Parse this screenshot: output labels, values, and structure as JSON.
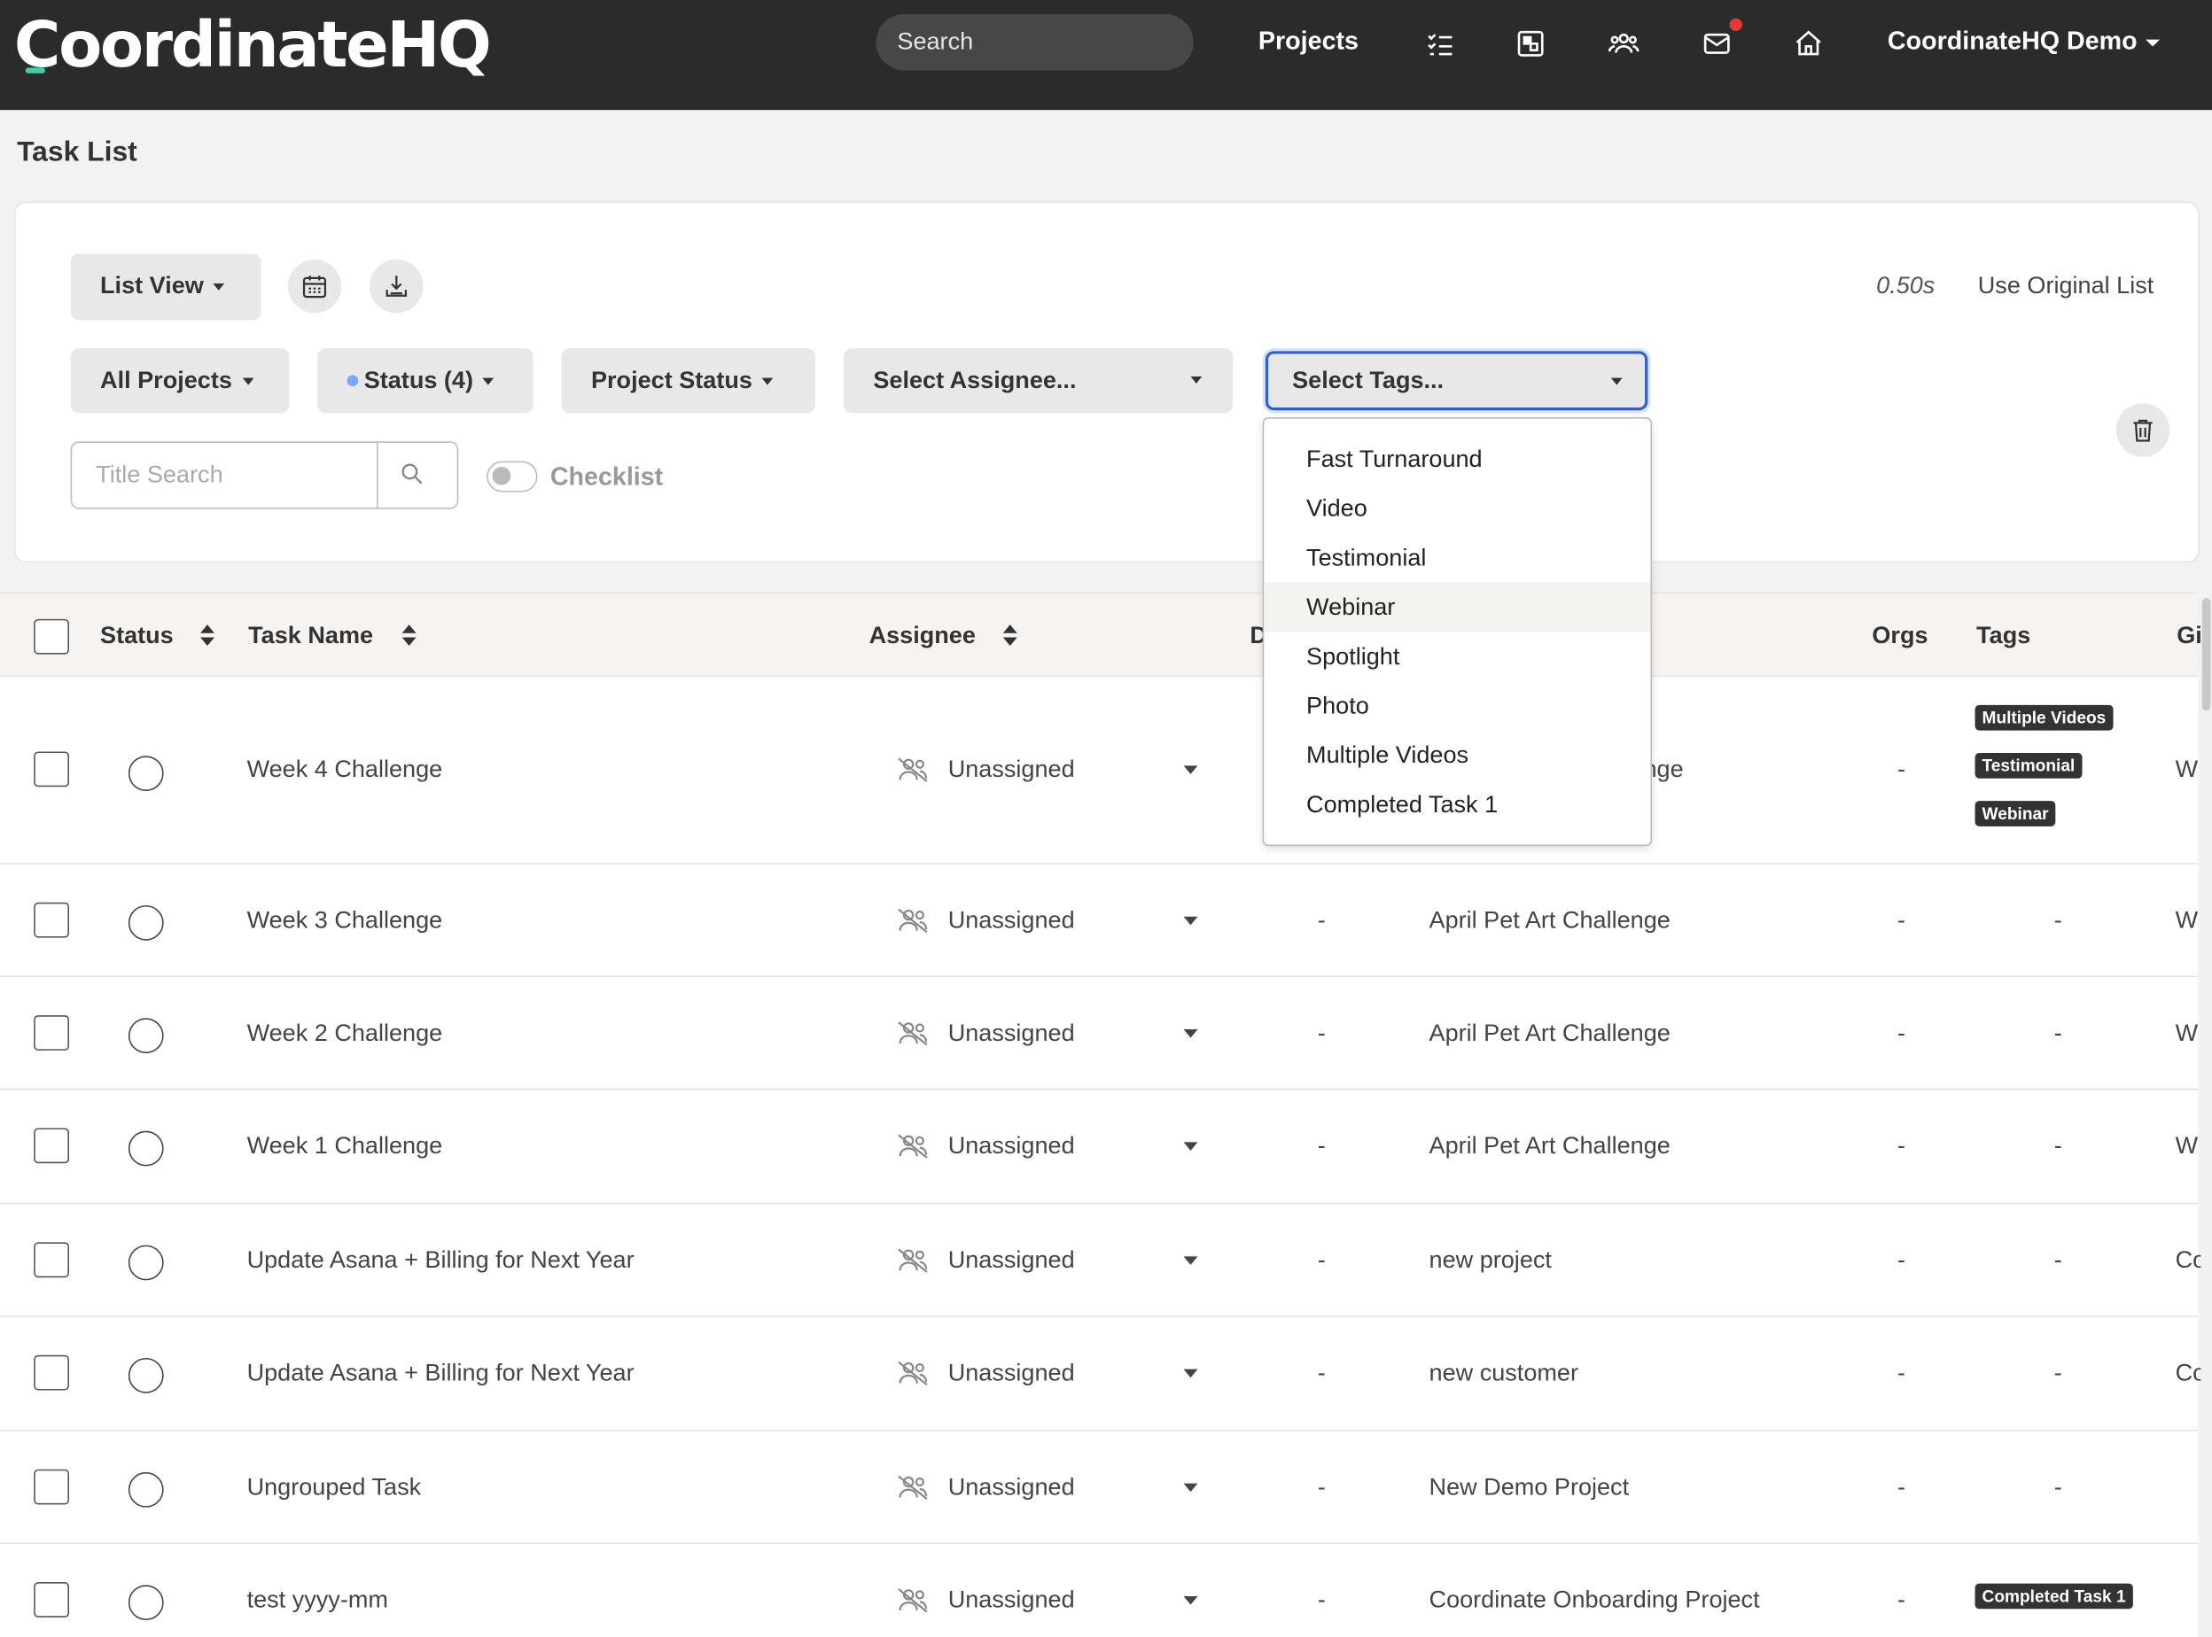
{
  "nav": {
    "logo": "CoordinateHQ",
    "search_placeholder": "Search",
    "projects": "Projects",
    "user": "CoordinateHQ Demo"
  },
  "page": {
    "title": "Task List"
  },
  "filters": {
    "view": "List View",
    "timer": "0.50s",
    "use_original": "Use Original List",
    "all_projects": "All Projects",
    "status": "Status (4)",
    "project_status": "Project Status",
    "assignee": "Select Assignee...",
    "tags": "Select Tags...",
    "title_search_placeholder": "Title Search",
    "checklist": "Checklist",
    "checklist_on": false
  },
  "tag_dropdown": {
    "items": [
      "Fast Turnaround",
      "Video",
      "Testimonial",
      "Webinar",
      "Spotlight",
      "Photo",
      "Multiple Videos",
      "Completed Task 1"
    ],
    "hovered": "Webinar"
  },
  "table": {
    "headers": {
      "status": "Status",
      "task_name": "Task Name",
      "assignee": "Assignee",
      "due_partial": "D",
      "orgs": "Orgs",
      "tags": "Tags",
      "group_partial": "Gi"
    },
    "rows": [
      {
        "task": "Week 4 Challenge",
        "assignee": "Unassigned",
        "due": "",
        "project": "nge",
        "orgs": "-",
        "tags": [
          "Multiple Videos",
          "Testimonial",
          "Webinar"
        ],
        "group": "W"
      },
      {
        "task": "Week 3 Challenge",
        "assignee": "Unassigned",
        "due": "-",
        "project": "April Pet Art Challenge",
        "orgs": "-",
        "tags_text": "-",
        "group": "W"
      },
      {
        "task": "Week 2 Challenge",
        "assignee": "Unassigned",
        "due": "-",
        "project": "April Pet Art Challenge",
        "orgs": "-",
        "tags_text": "-",
        "group": "W"
      },
      {
        "task": "Week 1 Challenge",
        "assignee": "Unassigned",
        "due": "-",
        "project": "April Pet Art Challenge",
        "orgs": "-",
        "tags_text": "-",
        "group": "W"
      },
      {
        "task": "Update Asana + Billing for Next Year",
        "assignee": "Unassigned",
        "due": "-",
        "project": "new project",
        "orgs": "-",
        "tags_text": "-",
        "group": "Co"
      },
      {
        "task": "Update Asana + Billing for Next Year",
        "assignee": "Unassigned",
        "due": "-",
        "project": "new customer",
        "orgs": "-",
        "tags_text": "-",
        "group": "Co"
      },
      {
        "task": "Ungrouped Task",
        "assignee": "Unassigned",
        "due": "-",
        "project": "New Demo Project",
        "orgs": "-",
        "tags_text": "-",
        "group": ""
      },
      {
        "task": "test yyyy-mm",
        "assignee": "Unassigned",
        "due": "-",
        "project": "Coordinate Onboarding Project",
        "orgs": "-",
        "tags": [
          "Completed Task 1"
        ],
        "group": ""
      }
    ]
  },
  "colors": {
    "topbar": "#2b2b2b",
    "accent": "#3dd1a7",
    "focus": "#2f5fd0",
    "notification": "#e53935",
    "tag_bg": "#333333"
  }
}
